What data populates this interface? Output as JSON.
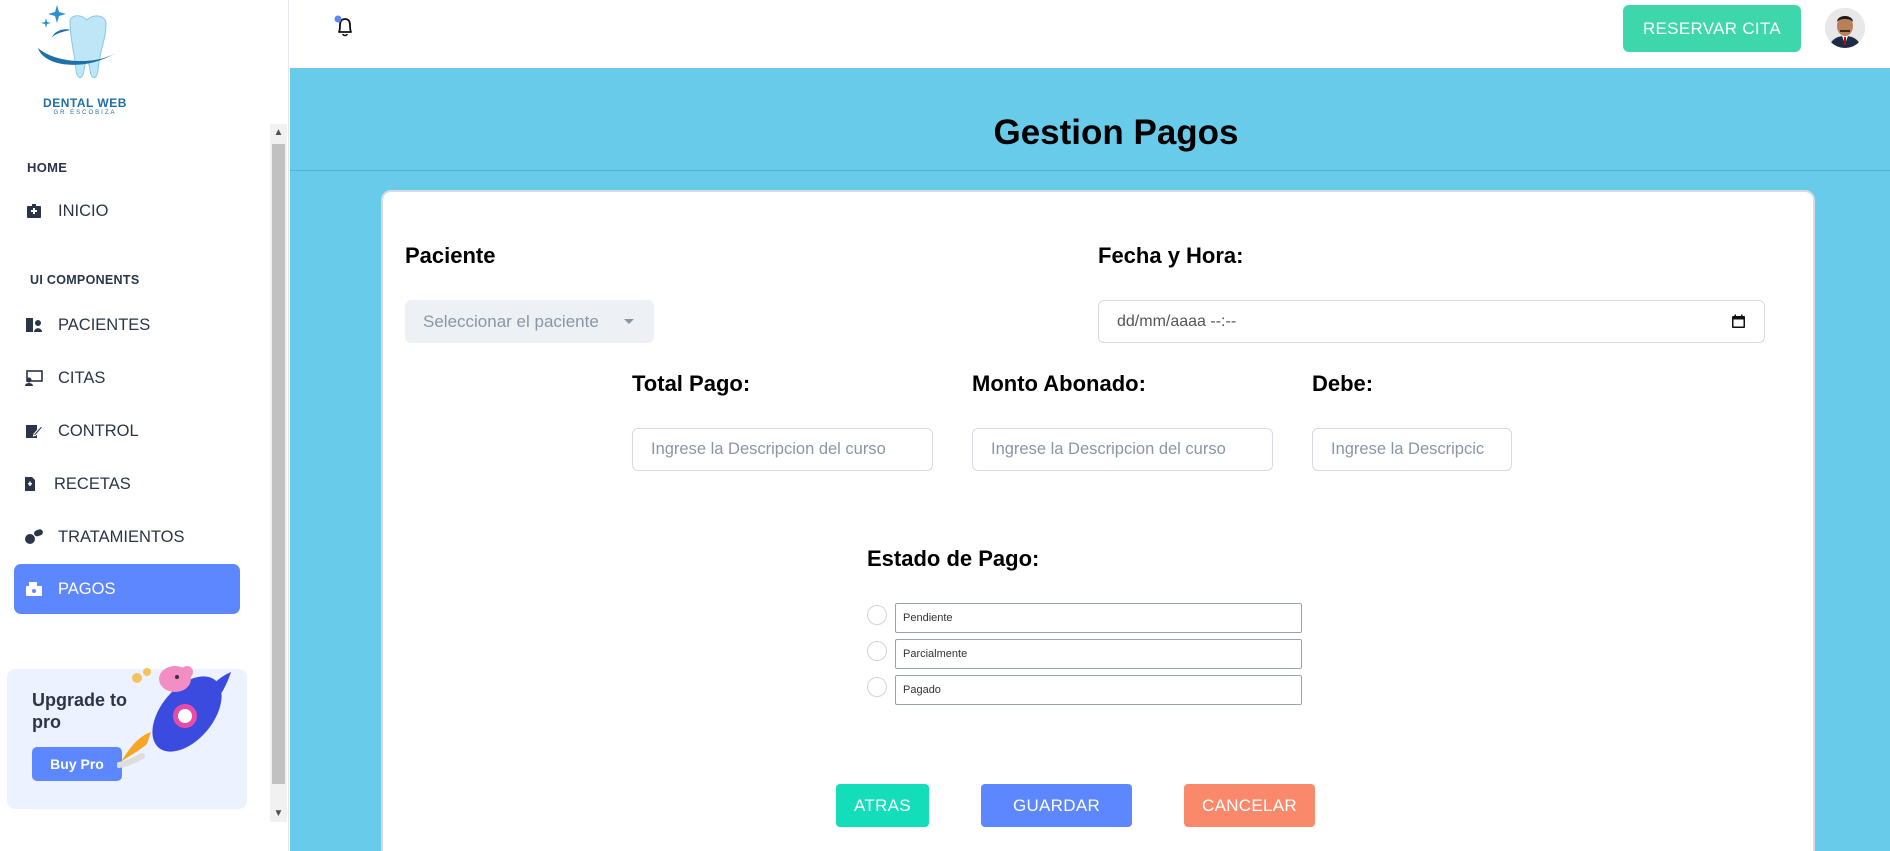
{
  "brand": {
    "name": "DENTAL WEB",
    "tagline": "GR ESCOBIZA"
  },
  "sidebar": {
    "sections": [
      {
        "label": "HOME"
      },
      {
        "label": "UI COMPONENTS"
      }
    ],
    "items": [
      {
        "label": "INICIO",
        "icon": "hospital-icon"
      },
      {
        "label": "PACIENTES",
        "icon": "patient-icon"
      },
      {
        "label": "CITAS",
        "icon": "appointment-icon"
      },
      {
        "label": "CONTROL",
        "icon": "edit-file-icon"
      },
      {
        "label": "RECETAS",
        "icon": "prescription-icon"
      },
      {
        "label": "TRATAMIENTOS",
        "icon": "pills-icon"
      },
      {
        "label": "PAGOS",
        "icon": "payment-icon",
        "active": true
      }
    ],
    "upgrade": {
      "title": "Upgrade to pro",
      "button": "Buy Pro"
    }
  },
  "header": {
    "reserve_button": "RESERVAR CITA",
    "colors": {
      "reserve": "#3ed7ab"
    }
  },
  "page": {
    "title": "Gestion Pagos",
    "background": "#69cbea"
  },
  "form": {
    "paciente": {
      "label": "Paciente",
      "placeholder": "Seleccionar el paciente"
    },
    "fecha": {
      "label": "Fecha y Hora:",
      "value": "dd/mm/aaaa --:--"
    },
    "total": {
      "label": "Total Pago:",
      "placeholder": "Ingrese la Descripcion del curso"
    },
    "monto": {
      "label": "Monto Abonado:",
      "placeholder": "Ingrese la Descripcion del curso"
    },
    "debe": {
      "label": "Debe:",
      "placeholder": "Ingrese la Descripcic"
    },
    "estado": {
      "label": "Estado de Pago:",
      "options": [
        "Pendiente",
        "Parcialmente",
        "Pagado"
      ]
    },
    "buttons": {
      "atras": "ATRAS",
      "guardar": "GUARDAR",
      "cancelar": "CANCELAR"
    },
    "colors": {
      "atras": "#13deb9",
      "guardar": "#5d87ff",
      "cancelar": "#fa896b"
    }
  }
}
